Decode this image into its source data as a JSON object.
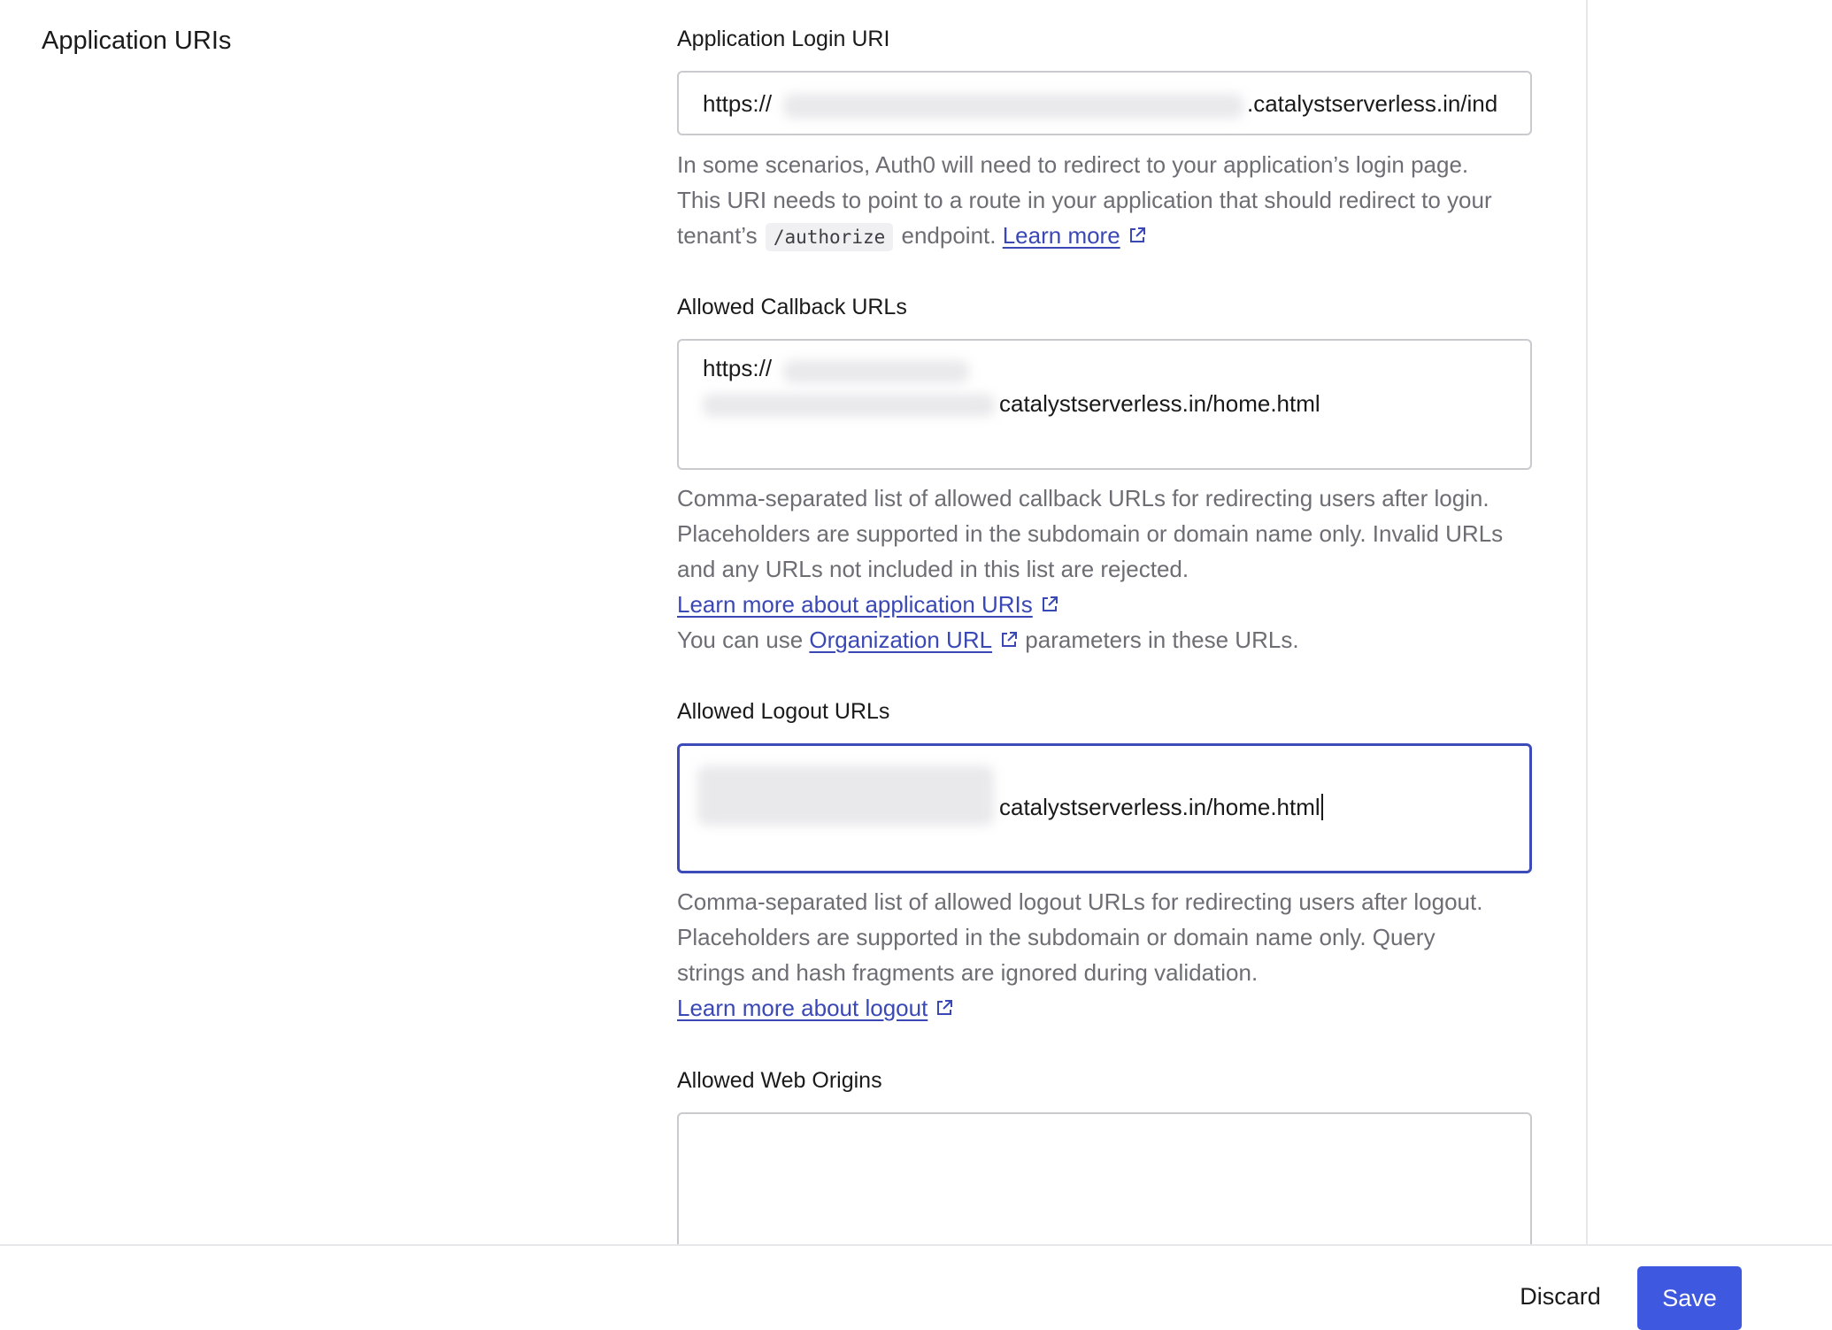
{
  "section": {
    "title": "Application URIs"
  },
  "login_uri": {
    "label": "Application Login URI",
    "value_prefix": "https://",
    "value_suffix": ".catalystserverless.in/ind",
    "help_line1": "In some scenarios, Auth0 will need to redirect to your application’s login page.",
    "help_line2": "This URI needs to point to a route in your application that should redirect to your",
    "help_line3_before": "tenant’s",
    "help_code": "/authorize",
    "help_line3_after": "endpoint.",
    "help_link": "Learn more"
  },
  "callback_urls": {
    "label": "Allowed Callback URLs",
    "value_line1": "https://",
    "value_line2_suffix": "catalystserverless.in/home.html",
    "help_line1": "Comma-separated list of allowed callback URLs for redirecting users after login.",
    "help_line2": "Placeholders are supported in the subdomain or domain name only. Invalid URLs",
    "help_line3": "and any URLs not included in this list are rejected.",
    "help_link1": "Learn more about application URIs",
    "help_line5_before": "You can use",
    "help_link2": "Organization URL",
    "help_line5_after": "parameters in these URLs."
  },
  "logout_urls": {
    "label": "Allowed Logout URLs",
    "value_suffix": "catalystserverless.in/home.html",
    "help_line1": "Comma-separated list of allowed logout URLs for redirecting users after logout.",
    "help_line2": "Placeholders are supported in the subdomain or domain name only. Query",
    "help_line3": "strings and hash fragments are ignored during validation.",
    "help_link": "Learn more about logout"
  },
  "web_origins": {
    "label": "Allowed Web Origins",
    "value": ""
  },
  "footer": {
    "discard_label": "Discard",
    "save_label": "Save"
  },
  "colors": {
    "accent": "#3f58e0",
    "link": "#3a48b5",
    "focus_border": "#3d4bb8"
  },
  "icons": {
    "external_link": "external-link-icon"
  }
}
